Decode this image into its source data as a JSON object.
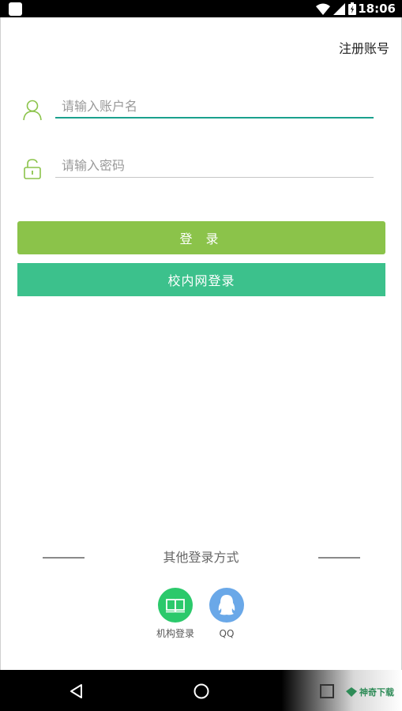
{
  "status_bar": {
    "time": "18:06"
  },
  "header": {
    "register_label": "注册账号"
  },
  "form": {
    "username_placeholder": "请输入账户名",
    "password_placeholder": "请输入密码",
    "login_label": "登 录",
    "campus_login_label": "校内网登录"
  },
  "other": {
    "title": "其他登录方式",
    "items": [
      {
        "label": "机构登录",
        "icon": "book-icon",
        "color": "#2bc96b"
      },
      {
        "label": "QQ",
        "icon": "qq-icon",
        "color": "#6aa8e8"
      }
    ]
  },
  "watermark": {
    "text": "神奇下载"
  },
  "colors": {
    "accent": "#1aa18d",
    "login": "#8bc34a",
    "campus": "#3cc18c",
    "icon_green": "#8bc34a"
  }
}
